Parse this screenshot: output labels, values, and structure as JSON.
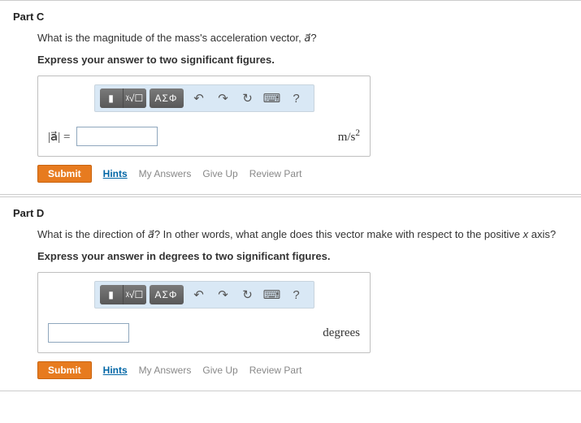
{
  "parts": [
    {
      "header": "Part C",
      "question_pre": "What is the magnitude of the mass's acceleration vector, ",
      "question_sym": "a⃗",
      "question_post": "?",
      "instruction": "Express your answer to two significant figures.",
      "lhs": "|a⃗| = ",
      "units_html": "m/s²",
      "show_lhs": true
    },
    {
      "header": "Part D",
      "question_pre": "What is the direction of ",
      "question_sym": "a⃗",
      "question_post": "? In other words, what angle does this vector make with respect to the positive ",
      "question_var": "x",
      "question_tail": " axis?",
      "instruction": "Express your answer in degrees to two significant figures.",
      "lhs": "",
      "units_html": "degrees",
      "show_lhs": false
    }
  ],
  "toolbar": {
    "template": "▮",
    "xroot": "ᵡ√☐",
    "greek": "AΣΦ",
    "undo": "↶",
    "redo": "↷",
    "reset": "↻",
    "keyboard": "⌨",
    "help": "?"
  },
  "actions": {
    "submit": "Submit",
    "hints": "Hints",
    "my_answers": "My Answers",
    "give_up": "Give Up",
    "review": "Review Part"
  }
}
